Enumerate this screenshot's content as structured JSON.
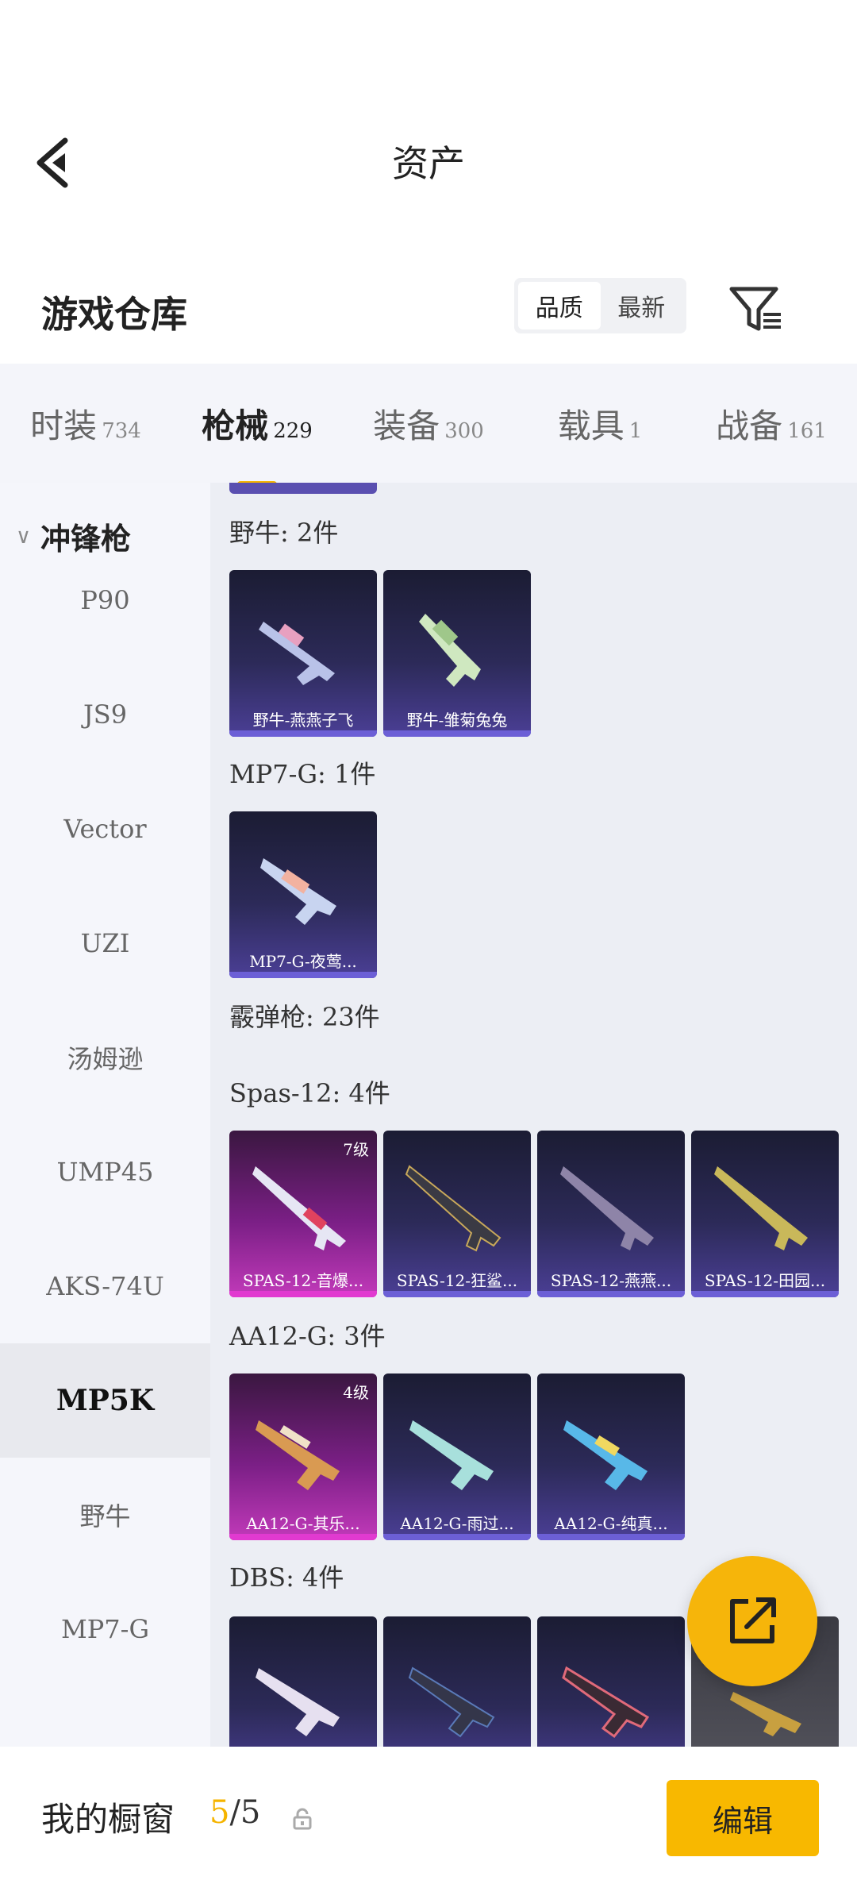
{
  "header": {
    "title": "资产"
  },
  "warehouse": {
    "title": "游戏仓库",
    "sort_options": [
      {
        "label": "品质",
        "active": true
      },
      {
        "label": "最新",
        "active": false
      }
    ]
  },
  "tabs": [
    {
      "label": "时装",
      "count": "734",
      "active": false
    },
    {
      "label": "枪械",
      "count": "229",
      "active": true
    },
    {
      "label": "装备",
      "count": "300",
      "active": false
    },
    {
      "label": "载具",
      "count": "1",
      "active": false
    },
    {
      "label": "战备",
      "count": "161",
      "active": false
    }
  ],
  "sidebar": {
    "category": "冲锋枪",
    "items": [
      "P90",
      "JS9",
      "Vector",
      "UZI",
      "汤姆逊",
      "UMP45",
      "AKS-74U",
      "MP5K",
      "野牛",
      "MP7-G"
    ],
    "active_item": "MP5K"
  },
  "content": {
    "groups": [
      {
        "title": "野牛: 2件",
        "items": [
          {
            "name": "野牛-燕燕子飞",
            "level": ""
          },
          {
            "name": "野牛-雏菊兔兔",
            "level": ""
          }
        ]
      },
      {
        "title": "MP7-G: 1件",
        "items": [
          {
            "name": "MP7-G-夜莺...",
            "level": ""
          }
        ]
      },
      {
        "title": "霰弹枪: 23件",
        "items": []
      },
      {
        "title": "Spas-12: 4件",
        "items": [
          {
            "name": "SPAS-12-音爆...",
            "level": "7级"
          },
          {
            "name": "SPAS-12-狂鲨...",
            "level": ""
          },
          {
            "name": "SPAS-12-燕燕...",
            "level": ""
          },
          {
            "name": "SPAS-12-田园...",
            "level": ""
          }
        ]
      },
      {
        "title": "AA12-G: 3件",
        "items": [
          {
            "name": "AA12-G-其乐...",
            "level": "4级"
          },
          {
            "name": "AA12-G-雨过...",
            "level": ""
          },
          {
            "name": "AA12-G-纯真...",
            "level": ""
          }
        ]
      },
      {
        "title": "DBS: 4件",
        "items": []
      }
    ]
  },
  "bottom": {
    "window_label": "我的橱窗",
    "count_current": "5",
    "count_total": "/5",
    "edit_label": "编辑"
  },
  "colors": {
    "accent": "#f5b400",
    "card_purple": "#4b3f96",
    "card_pink": "#c23aba"
  }
}
